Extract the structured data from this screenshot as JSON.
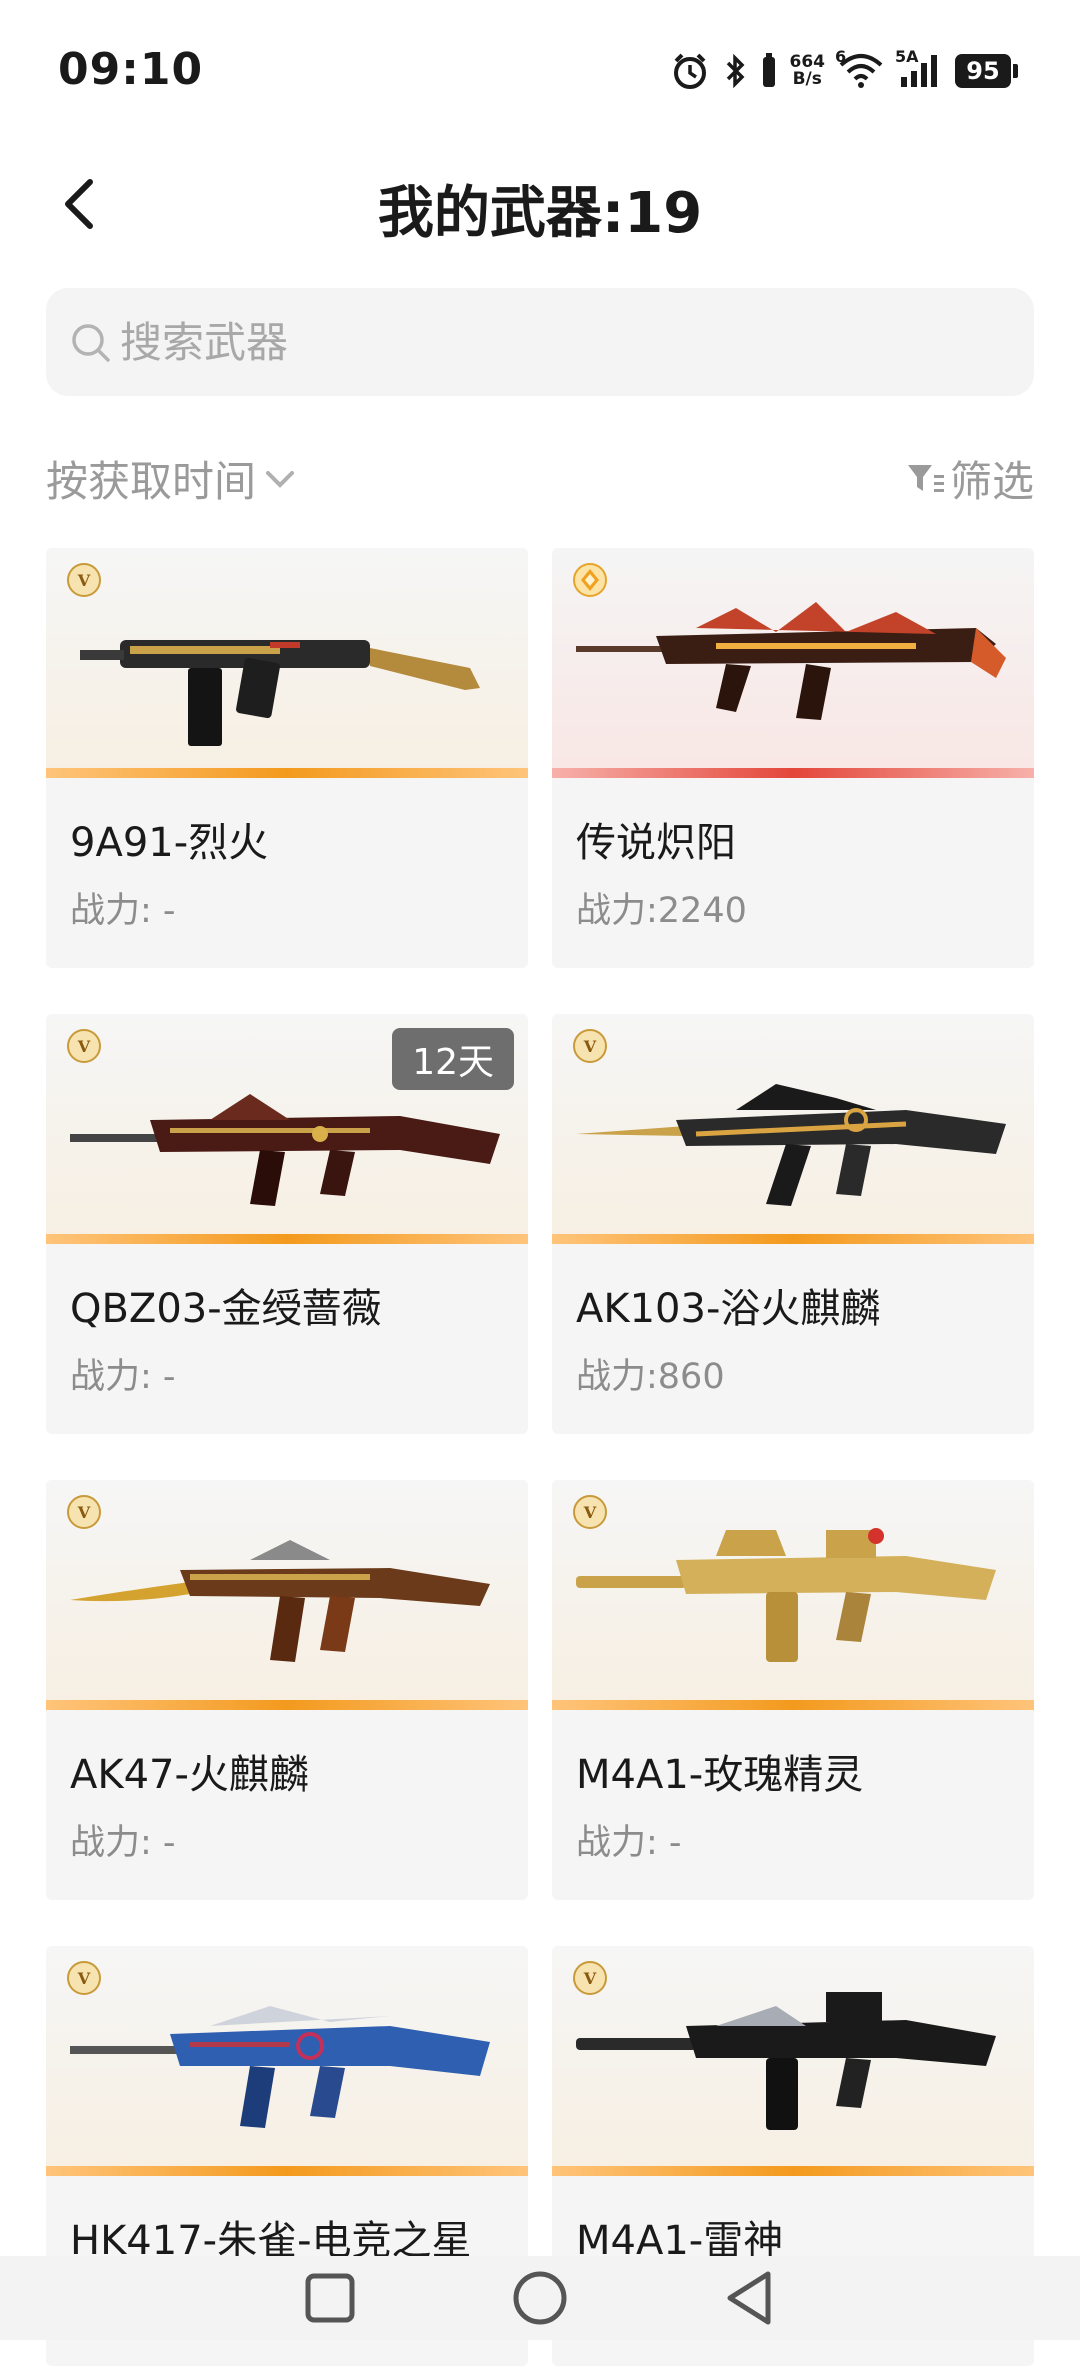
{
  "status_bar": {
    "time": "09:10",
    "net_speed_value": "664",
    "net_speed_unit": "B/s",
    "wifi_label": "6",
    "signal_label": "5A",
    "battery": "95"
  },
  "header": {
    "title": "我的武器:19"
  },
  "search": {
    "placeholder": "搜索武器"
  },
  "sort": {
    "label": "按获取时间"
  },
  "filter": {
    "label": "筛选"
  },
  "weapons": [
    {
      "name": "9A91-烈火",
      "power": "战力: -",
      "badge": "V",
      "tone": "gold",
      "icon": "smg-weapon"
    },
    {
      "name": "传说炽阳",
      "power": "战力:2240",
      "badge": "legend",
      "tone": "red",
      "icon": "rifle-weapon"
    },
    {
      "name": "QBZ03-金绶蔷薇",
      "power": "战力: -",
      "badge": "V",
      "tone": "gold",
      "days": "12天",
      "icon": "rifle-weapon"
    },
    {
      "name": "AK103-浴火麒麟",
      "power": "战力:860",
      "badge": "V",
      "tone": "gold",
      "icon": "rifle-weapon"
    },
    {
      "name": "AK47-火麒麟",
      "power": "战力: -",
      "badge": "V",
      "tone": "gold",
      "icon": "rifle-weapon"
    },
    {
      "name": "M4A1-玫瑰精灵",
      "power": "战力: -",
      "badge": "V",
      "tone": "gold",
      "icon": "rifle-weapon"
    },
    {
      "name": "HK417-朱雀-电竞之星",
      "power": "",
      "badge": "V",
      "tone": "gold",
      "icon": "rifle-weapon"
    },
    {
      "name": "M4A1-雷神",
      "power": "",
      "badge": "V",
      "tone": "gold",
      "icon": "rifle-weapon"
    }
  ],
  "colors": {
    "accent_orange": "#f39a1e",
    "accent_red": "#e4463a",
    "text_primary": "#1a1a1a",
    "text_secondary": "#8c8c8c"
  }
}
